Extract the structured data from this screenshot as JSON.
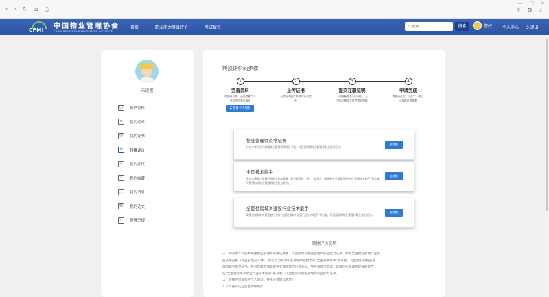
{
  "browser": {
    "nav_icons": [
      "back-icon",
      "forward-icon",
      "refresh-icon",
      "home-icon",
      "history-icon"
    ],
    "window_controls": [
      "—",
      "□",
      "✕"
    ],
    "tool_icons": [
      "share-icon",
      "settings-icon",
      "bookmark-icon"
    ]
  },
  "header": {
    "logo_abbr": "CPMI",
    "logo_cn": "中国物业管理协会",
    "logo_en": "CHINA PROPERTY MANAGEMENT INSTITUTE",
    "nav": [
      "首页",
      "职业能力等级评价",
      "考试报名"
    ],
    "search_placeholder": "搜索",
    "search_button": "搜索",
    "greeting": "您好！",
    "user_center": "个人中心",
    "logout": "退出"
  },
  "sidebar": {
    "username": "未设置",
    "items": [
      {
        "label": "账户资料",
        "icon": "user-icon"
      },
      {
        "label": "我的订单",
        "icon": "order-icon"
      },
      {
        "label": "我的证书",
        "icon": "certificate-icon"
      },
      {
        "label": "转换评价",
        "icon": "convert-icon",
        "active": true
      },
      {
        "label": "我的考试",
        "icon": "exam-icon"
      },
      {
        "label": "我的收藏",
        "icon": "favorite-icon"
      },
      {
        "label": "我的消息",
        "icon": "message-icon"
      },
      {
        "label": "我的论文",
        "icon": "paper-icon"
      },
      {
        "label": "投诉举报",
        "icon": "report-icon"
      }
    ]
  },
  "main": {
    "title": "转换评价的步骤",
    "steps": [
      {
        "num": "1",
        "title": "完善资料",
        "desc": "转换评价前，必须完善个人资料中所有必填项",
        "button": "去完善个人资料"
      },
      {
        "num": "2",
        "title": "上传证书",
        "desc": "上传证书图片并填写证书信息",
        "button": ""
      },
      {
        "num": "3",
        "title": "提交在职证明",
        "desc": "下载模板盖公司公章后，上传PDF格式文件并提交审核",
        "button": ""
      },
      {
        "num": "4",
        "title": "申请完成",
        "desc": "审核通过后，可在个人中心->我的证书查看",
        "button": ""
      }
    ],
    "cards": [
      {
        "title": "物业管理师资格证书",
        "desc": "持有中华人民共和国物业管理师资格证书者，可直接取得物业管理师职业能力证书。",
        "button": "去转换"
      },
      {
        "title": "全国技术能手",
        "desc": "参加全国物业管理行业职业技能竞赛（物业管理员工种），取得人力资源和社会保障部授予的“全国技术能手”称号者，可直接取得物业管理师职业能力证书。",
        "button": "去转换"
      },
      {
        "title": "全国住房城乡建设行业技术能手",
        "desc": "取得住房和城乡建设部授予的“全国住房城乡建设行业技术能手”称号者，可直接取得物业管理师职业能力证书。",
        "button": "去转换"
      }
    ],
    "explain_title": "转换评价说明",
    "explain_lines": [
      "一、持有中华人民共和国物业管理师资格证书者，可直接取得物业管理师职业能力证书。参加全国物业管理行业职",
      "业技能竞赛（物业管理员工种），取得人力资源和社会保障部授予的“全国技术能手”称号者，可直接取得物业管",
      "理师职业能力证书，并可直接申请高级物业管理师的论文答辩，免考该岗位考试，取得住房和城乡建设部授予",
      "的“全国住房城乡建设行业技术能手”称号者，可直接取得物业管理师职业能力证书。",
      "二、转换评价需提供个人资料，要求必须填写清楚：",
      "1.个人身份证正反面清晰照片"
    ]
  }
}
